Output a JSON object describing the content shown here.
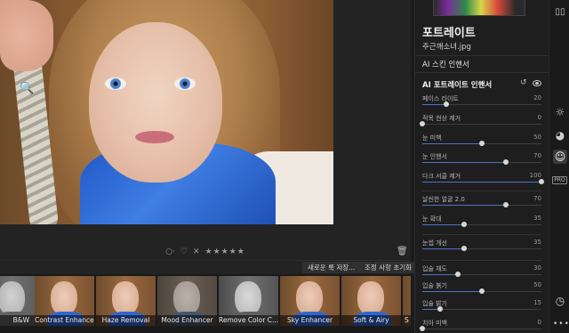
{
  "panel": {
    "title": "포트레이트",
    "file_name": "주근깨소녀.jpg",
    "skin_section": "AI 스킨 인핸서",
    "portrait_section": "AI 포트레이트 인핸서"
  },
  "sliders": [
    {
      "name": "페이스 라이트",
      "value": 20
    },
    {
      "name": "적목 현상 제거",
      "value": 0
    },
    {
      "name": "눈 미백",
      "value": 50
    },
    {
      "name": "눈 인핸서",
      "value": 70
    },
    {
      "name": "다크 서클 제거",
      "value": 100
    },
    {
      "name": "날씬한 얼굴 2.0",
      "value": 70
    },
    {
      "name": "눈 확대",
      "value": 35
    },
    {
      "name": "눈썹 개선",
      "value": 35
    },
    {
      "name": "입술 채도",
      "value": 30
    },
    {
      "name": "입술 붉기",
      "value": 50
    },
    {
      "name": "입술 밝기",
      "value": 15
    },
    {
      "name": "치아 미백",
      "value": 0
    }
  ],
  "rating": {
    "stars": "★★★★★"
  },
  "actions": {
    "save_preset": "새로운 룩 저장...",
    "reset_adjust": "조정 사항 초기화"
  },
  "filmstrip": [
    {
      "label": "B&W"
    },
    {
      "label": "Contrast Enhancer"
    },
    {
      "label": "Haze Removal"
    },
    {
      "label": "Mood Enhancer"
    },
    {
      "label": "Remove Color C..."
    },
    {
      "label": "Sky Enhancer"
    },
    {
      "label": "Soft & Airy"
    },
    {
      "label": "S"
    }
  ],
  "toolbar": {
    "pro_badge": "PRO"
  },
  "colors": {
    "accent": "#4e73c8",
    "background": "#1b1b1b"
  }
}
